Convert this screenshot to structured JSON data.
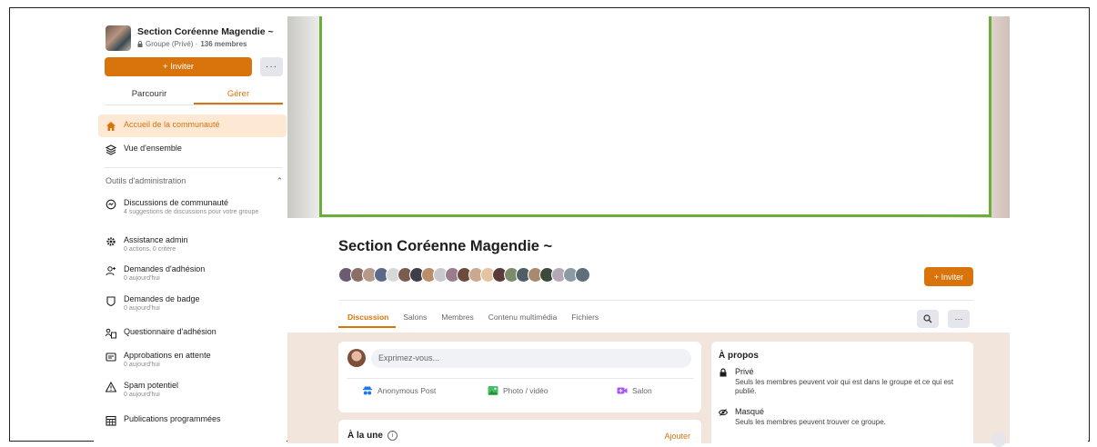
{
  "colors": {
    "accent": "#d9740c",
    "cover_border": "#6aae3b",
    "feed_bg": "#f2e6dc"
  },
  "sidebar": {
    "group_name": "Section Coréenne Magendie ~",
    "group_privacy": "Groupe (Privé) ·",
    "group_members": "136 membres",
    "invite_label": "+ Inviter",
    "more_label": "···",
    "tabs": [
      {
        "label": "Parcourir"
      },
      {
        "label": "Gérer"
      }
    ],
    "nav_top": [
      {
        "label": "Accueil de la communauté",
        "icon": "home-icon"
      },
      {
        "label": "Vue d'ensemble",
        "icon": "overview-icon"
      }
    ],
    "admin_tools_label": "Outils d'administration",
    "admin_tools_chevron": "⌃",
    "admin_items": [
      {
        "label": "Discussions de communauté",
        "sub": "4 suggestions de discussions pour votre groupe",
        "icon": "discussion-icon"
      },
      {
        "label": "Assistance admin",
        "sub": "0 actions, 0 critère",
        "icon": "gear-icon"
      },
      {
        "label": "Demandes d'adhésion",
        "sub": "0 aujourd'hui",
        "icon": "add-person-icon"
      },
      {
        "label": "Demandes de badge",
        "sub": "0 aujourd'hui",
        "icon": "badge-icon"
      },
      {
        "label": "Questionnaire d'adhésion",
        "sub": "",
        "icon": "questionnaire-icon"
      },
      {
        "label": "Approbations en attente",
        "sub": "0 aujourd'hui",
        "icon": "pending-icon"
      },
      {
        "label": "Spam potentiel",
        "sub": "0 aujourd'hui",
        "icon": "warning-icon"
      },
      {
        "label": "Publications programmées",
        "sub": "",
        "icon": "calendar-icon"
      }
    ]
  },
  "main": {
    "title": "Section Coréenne Magendie ~",
    "invite_label": "+ Inviter",
    "tabs": [
      {
        "label": "Discussion"
      },
      {
        "label": "Salons"
      },
      {
        "label": "Membres"
      },
      {
        "label": "Contenu multimédia"
      },
      {
        "label": "Fichiers"
      }
    ],
    "search_icon": "search-icon",
    "more_label": "···",
    "composer": {
      "placeholder": "Exprimez-vous...",
      "actions": [
        {
          "label": "Anonymous Post",
          "icon": "anonymous-icon"
        },
        {
          "label": "Photo / vidéo",
          "icon": "photo-icon"
        },
        {
          "label": "Salon",
          "icon": "video-room-icon"
        }
      ]
    },
    "featured": {
      "label": "À la une",
      "info": "i",
      "add_label": "Ajouter"
    },
    "about": {
      "title": "À propos",
      "items": [
        {
          "title": "Privé",
          "desc": "Seuls les membres peuvent voir qui est dans le groupe et ce qui est publié.",
          "icon": "lock-icon"
        },
        {
          "title": "Masqué",
          "desc": "Seuls les membres peuvent trouver ce groupe.",
          "icon": "eye-hidden-icon"
        }
      ]
    }
  }
}
